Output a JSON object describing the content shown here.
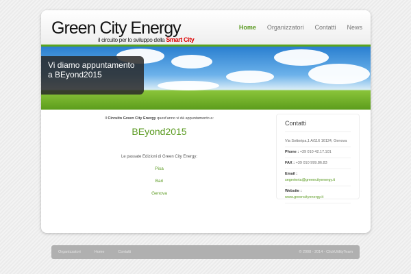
{
  "header": {
    "logo": "Green City Energy",
    "tagline": "il circuito per lo sviluppo della",
    "tagline_highlight": "Smart City"
  },
  "nav": [
    "Home",
    "Organizzatori",
    "Contatti",
    "News"
  ],
  "hero": {
    "caption": "Vi diamo appuntamento a BEyond2015"
  },
  "main": {
    "intro_prefix": "Il",
    "intro_bold": "Circuito Green City Energy",
    "intro_suffix": "quest'anno vi dà appuntamento a:",
    "event": "BEyond2015",
    "past_label": "Le passate Edizioni di Green City Energy:",
    "past_cities": [
      "Pisa",
      "Bari",
      "Genova"
    ]
  },
  "contacts": {
    "title": "Contatti",
    "address": "Via Sottoripa,1 A/116 16124, Genova",
    "phone_label": "Phone :",
    "phone": "+39 010 42.17.101",
    "fax_label": "FAX :",
    "fax": "+39 010 999.86.83",
    "email_label": "Email :",
    "email": "segreteria@greencityenergy.it",
    "website_label": "Website :",
    "website": "www.greencityenergy.it"
  },
  "footer": {
    "links": [
      "Organizzatori",
      "Home",
      "Contatti"
    ],
    "copyright": "© 2008 - 2014 - ClickUtilityTeam"
  }
}
